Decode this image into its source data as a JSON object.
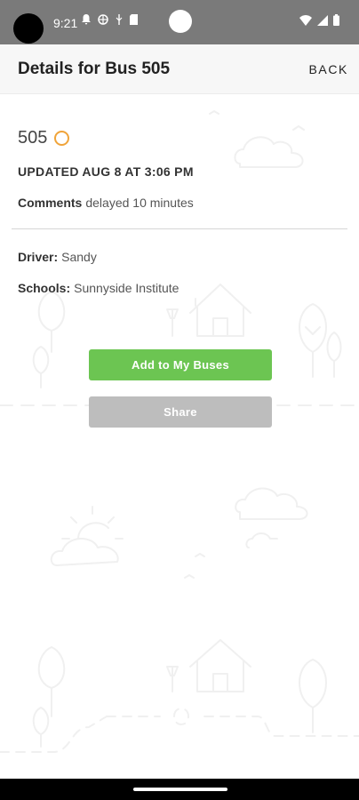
{
  "status_bar": {
    "time": "9:21",
    "left_icons": [
      "notification-bell-icon",
      "vpn-globe-icon",
      "usb-icon",
      "sd-card-icon"
    ],
    "right_icons": [
      "wifi-icon",
      "signal-icon",
      "battery-icon"
    ]
  },
  "app_bar": {
    "title": "Details for Bus 505",
    "back_label": "BACK"
  },
  "bus": {
    "number": "505",
    "status_color": "#f0a43a",
    "updated": "UPDATED AUG 8 AT 3:06 PM",
    "comments_label": "Comments",
    "comments_value": "delayed 10 minutes",
    "driver_label": "Driver:",
    "driver_value": "Sandy",
    "schools_label": "Schools:",
    "schools_value": "Sunnyside Institute"
  },
  "actions": {
    "add_label": "Add to My Buses",
    "share_label": "Share"
  },
  "colors": {
    "accent_green": "#6cc552",
    "disabled_gray": "#bdbdbd"
  }
}
